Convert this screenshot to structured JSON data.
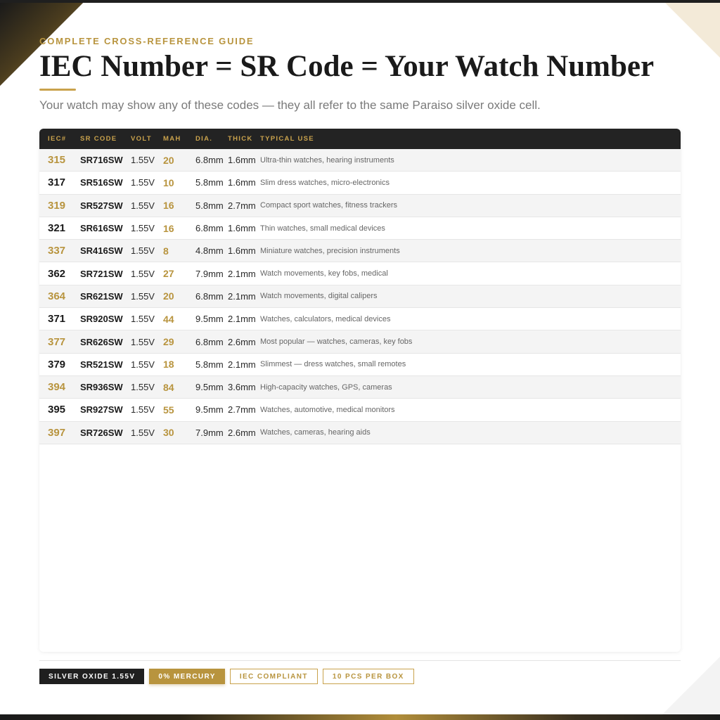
{
  "header": {
    "eyebrow": "COMPLETE CROSS-REFERENCE GUIDE",
    "title": "IEC Number = SR Code = Your Watch Number",
    "subtitle": "Your watch may show any of these codes — they all refer to the same Paraiso silver oxide cell."
  },
  "table": {
    "columns": [
      "IEC#",
      "SR CODE",
      "VOLT",
      "MAH",
      "DIA.",
      "THICK",
      "TYPICAL USE"
    ],
    "rows": [
      [
        "315",
        "SR716SW",
        "1.55V",
        "20",
        "6.8mm",
        "1.6mm",
        "Ultra-thin watches, hearing instruments"
      ],
      [
        "317",
        "SR516SW",
        "1.55V",
        "10",
        "5.8mm",
        "1.6mm",
        "Slim dress watches, micro-electronics"
      ],
      [
        "319",
        "SR527SW",
        "1.55V",
        "16",
        "5.8mm",
        "2.7mm",
        "Compact sport watches, fitness trackers"
      ],
      [
        "321",
        "SR616SW",
        "1.55V",
        "16",
        "6.8mm",
        "1.6mm",
        "Thin watches, small medical devices"
      ],
      [
        "337",
        "SR416SW",
        "1.55V",
        "8",
        "4.8mm",
        "1.6mm",
        "Miniature watches, precision instruments"
      ],
      [
        "362",
        "SR721SW",
        "1.55V",
        "27",
        "7.9mm",
        "2.1mm",
        "Watch movements, key fobs, medical"
      ],
      [
        "364",
        "SR621SW",
        "1.55V",
        "20",
        "6.8mm",
        "2.1mm",
        "Watch movements, digital calipers"
      ],
      [
        "371",
        "SR920SW",
        "1.55V",
        "44",
        "9.5mm",
        "2.1mm",
        "Watches, calculators, medical devices"
      ],
      [
        "377",
        "SR626SW",
        "1.55V",
        "29",
        "6.8mm",
        "2.6mm",
        "Most popular — watches, cameras, key fobs"
      ],
      [
        "379",
        "SR521SW",
        "1.55V",
        "18",
        "5.8mm",
        "2.1mm",
        "Slimmest — dress watches, small remotes"
      ],
      [
        "394",
        "SR936SW",
        "1.55V",
        "84",
        "9.5mm",
        "3.6mm",
        "High-capacity watches, GPS, cameras"
      ],
      [
        "395",
        "SR927SW",
        "1.55V",
        "55",
        "9.5mm",
        "2.7mm",
        "Watches, automotive, medical monitors"
      ],
      [
        "397",
        "SR726SW",
        "1.55V",
        "30",
        "7.9mm",
        "2.6mm",
        "Watches, cameras, hearing aids"
      ]
    ]
  },
  "badges": [
    {
      "label": "SILVER OXIDE 1.55V",
      "style": "dark"
    },
    {
      "label": "0% MERCURY",
      "style": "gold"
    },
    {
      "label": "IEC COMPLIANT",
      "style": "outline"
    },
    {
      "label": "10 PCS PER BOX",
      "style": "outline"
    }
  ],
  "colors": {
    "accent_gold": "#b8943e",
    "header_dark": "#232323",
    "text_dark": "#1a1a1a",
    "text_muted": "#7a7a7a"
  }
}
